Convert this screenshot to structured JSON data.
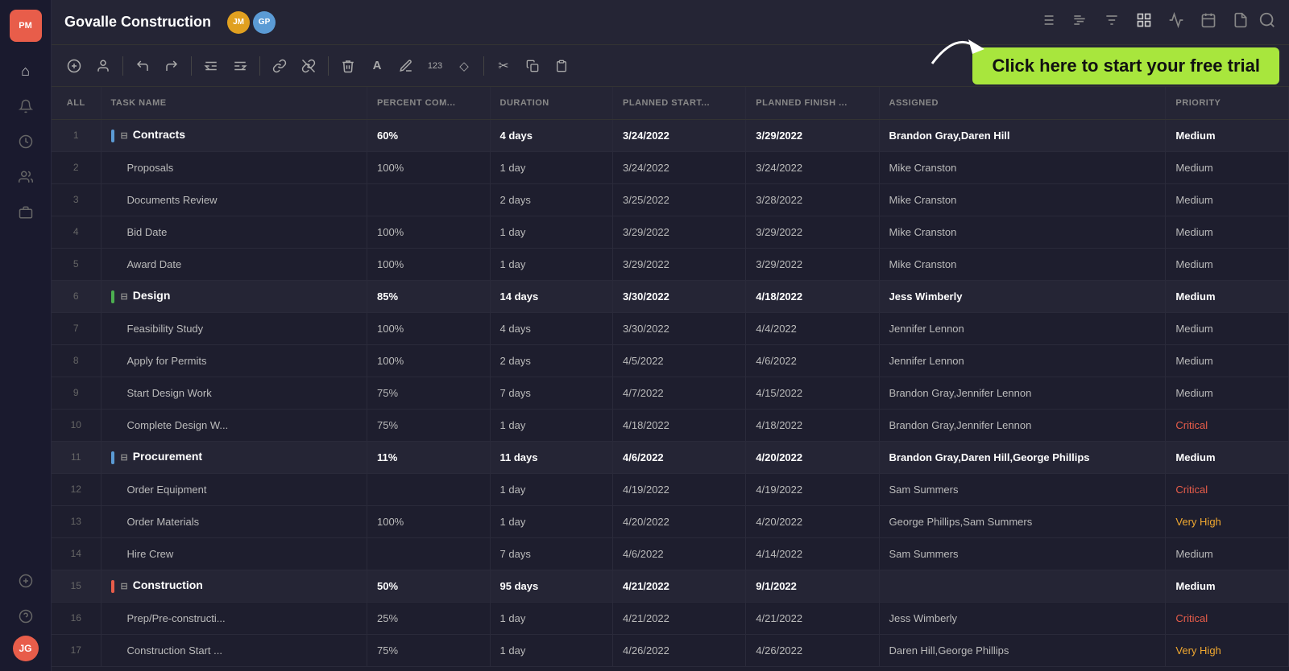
{
  "app": {
    "logo": "PM",
    "project_title": "Govalle Construction",
    "cta_text": "Click here to start your free trial"
  },
  "sidebar": {
    "icons": [
      {
        "name": "home-icon",
        "glyph": "⌂"
      },
      {
        "name": "bell-icon",
        "glyph": "🔔"
      },
      {
        "name": "clock-icon",
        "glyph": "🕐"
      },
      {
        "name": "people-icon",
        "glyph": "👥"
      },
      {
        "name": "briefcase-icon",
        "glyph": "💼"
      },
      {
        "name": "plus-icon",
        "glyph": "+"
      },
      {
        "name": "question-icon",
        "glyph": "?"
      }
    ],
    "user_avatar": "JG"
  },
  "topbar": {
    "avatar1": {
      "initials": "JM",
      "color": "#e0a020"
    },
    "avatar2": {
      "initials": "GP",
      "color": "#5b9bd5"
    },
    "icons": [
      {
        "name": "list-icon",
        "glyph": "☰"
      },
      {
        "name": "chart-icon",
        "glyph": "📊"
      },
      {
        "name": "menu-icon",
        "glyph": "≡"
      },
      {
        "name": "grid-icon",
        "glyph": "⊞"
      },
      {
        "name": "pulse-icon",
        "glyph": "∿"
      },
      {
        "name": "calendar-icon",
        "glyph": "📅"
      },
      {
        "name": "doc-icon",
        "glyph": "📄"
      }
    ]
  },
  "toolbar": {
    "buttons": [
      {
        "name": "add-task-btn",
        "glyph": "⊕"
      },
      {
        "name": "add-user-btn",
        "glyph": "👤"
      },
      {
        "name": "undo-btn",
        "glyph": "↩"
      },
      {
        "name": "redo-btn",
        "glyph": "↪"
      },
      {
        "name": "outdent-btn",
        "glyph": "⇐"
      },
      {
        "name": "indent-btn",
        "glyph": "⇒"
      },
      {
        "name": "link-btn",
        "glyph": "🔗"
      },
      {
        "name": "unlink-btn",
        "glyph": "⛓"
      },
      {
        "name": "delete-btn",
        "glyph": "🗑"
      },
      {
        "name": "font-btn",
        "glyph": "A"
      },
      {
        "name": "highlight-btn",
        "glyph": "✏"
      },
      {
        "name": "number-btn",
        "glyph": "123"
      },
      {
        "name": "shape-btn",
        "glyph": "◇"
      },
      {
        "name": "cut-btn",
        "glyph": "✂"
      },
      {
        "name": "copy-btn",
        "glyph": "⧉"
      },
      {
        "name": "paste-btn",
        "glyph": "📋"
      }
    ]
  },
  "table": {
    "columns": [
      {
        "key": "num",
        "label": "ALL",
        "class": "col-num"
      },
      {
        "key": "task",
        "label": "TASK NAME",
        "class": "col-task"
      },
      {
        "key": "pct",
        "label": "PERCENT COM...",
        "class": "col-pct"
      },
      {
        "key": "dur",
        "label": "DURATION",
        "class": "col-dur"
      },
      {
        "key": "ps",
        "label": "PLANNED START...",
        "class": "col-ps"
      },
      {
        "key": "pf",
        "label": "PLANNED FINISH ...",
        "class": "col-pf"
      },
      {
        "key": "assigned",
        "label": "ASSIGNED",
        "class": "col-assigned"
      },
      {
        "key": "pri",
        "label": "PRIORITY",
        "class": "col-pri"
      }
    ],
    "rows": [
      {
        "num": "1",
        "task": "Contracts",
        "pct": "60%",
        "dur": "4 days",
        "ps": "3/24/2022",
        "pf": "3/29/2022",
        "assigned": "Brandon Gray,Daren Hill",
        "pri": "Medium",
        "type": "group",
        "bar_color": "#5b9bd5"
      },
      {
        "num": "2",
        "task": "Proposals",
        "pct": "100%",
        "dur": "1 day",
        "ps": "3/24/2022",
        "pf": "3/24/2022",
        "assigned": "Mike Cranston",
        "pri": "Medium",
        "type": "child"
      },
      {
        "num": "3",
        "task": "Documents Review",
        "pct": "",
        "dur": "2 days",
        "ps": "3/25/2022",
        "pf": "3/28/2022",
        "assigned": "Mike Cranston",
        "pri": "Medium",
        "type": "child"
      },
      {
        "num": "4",
        "task": "Bid Date",
        "pct": "100%",
        "dur": "1 day",
        "ps": "3/29/2022",
        "pf": "3/29/2022",
        "assigned": "Mike Cranston",
        "pri": "Medium",
        "type": "child"
      },
      {
        "num": "5",
        "task": "Award Date",
        "pct": "100%",
        "dur": "1 day",
        "ps": "3/29/2022",
        "pf": "3/29/2022",
        "assigned": "Mike Cranston",
        "pri": "Medium",
        "type": "child"
      },
      {
        "num": "6",
        "task": "Design",
        "pct": "85%",
        "dur": "14 days",
        "ps": "3/30/2022",
        "pf": "4/18/2022",
        "assigned": "Jess Wimberly",
        "pri": "Medium",
        "type": "group",
        "bar_color": "#4caf50"
      },
      {
        "num": "7",
        "task": "Feasibility Study",
        "pct": "100%",
        "dur": "4 days",
        "ps": "3/30/2022",
        "pf": "4/4/2022",
        "assigned": "Jennifer Lennon",
        "pri": "Medium",
        "type": "child"
      },
      {
        "num": "8",
        "task": "Apply for Permits",
        "pct": "100%",
        "dur": "2 days",
        "ps": "4/5/2022",
        "pf": "4/6/2022",
        "assigned": "Jennifer Lennon",
        "pri": "Medium",
        "type": "child"
      },
      {
        "num": "9",
        "task": "Start Design Work",
        "pct": "75%",
        "dur": "7 days",
        "ps": "4/7/2022",
        "pf": "4/15/2022",
        "assigned": "Brandon Gray,Jennifer Lennon",
        "pri": "Medium",
        "type": "child"
      },
      {
        "num": "10",
        "task": "Complete Design W...",
        "pct": "75%",
        "dur": "1 day",
        "ps": "4/18/2022",
        "pf": "4/18/2022",
        "assigned": "Brandon Gray,Jennifer Lennon",
        "pri": "Critical",
        "type": "child"
      },
      {
        "num": "11",
        "task": "Procurement",
        "pct": "11%",
        "dur": "11 days",
        "ps": "4/6/2022",
        "pf": "4/20/2022",
        "assigned": "Brandon Gray,Daren Hill,George Phillips",
        "pri": "Medium",
        "type": "group",
        "bar_color": "#5b9bd5"
      },
      {
        "num": "12",
        "task": "Order Equipment",
        "pct": "",
        "dur": "1 day",
        "ps": "4/19/2022",
        "pf": "4/19/2022",
        "assigned": "Sam Summers",
        "pri": "Critical",
        "type": "child"
      },
      {
        "num": "13",
        "task": "Order Materials",
        "pct": "100%",
        "dur": "1 day",
        "ps": "4/20/2022",
        "pf": "4/20/2022",
        "assigned": "George Phillips,Sam Summers",
        "pri": "Very High",
        "type": "child"
      },
      {
        "num": "14",
        "task": "Hire Crew",
        "pct": "",
        "dur": "7 days",
        "ps": "4/6/2022",
        "pf": "4/14/2022",
        "assigned": "Sam Summers",
        "pri": "Medium",
        "type": "child"
      },
      {
        "num": "15",
        "task": "Construction",
        "pct": "50%",
        "dur": "95 days",
        "ps": "4/21/2022",
        "pf": "9/1/2022",
        "assigned": "",
        "pri": "Medium",
        "type": "group",
        "bar_color": "#e85d4a"
      },
      {
        "num": "16",
        "task": "Prep/Pre-constructi...",
        "pct": "25%",
        "dur": "1 day",
        "ps": "4/21/2022",
        "pf": "4/21/2022",
        "assigned": "Jess Wimberly",
        "pri": "Critical",
        "type": "child"
      },
      {
        "num": "17",
        "task": "Construction Start ...",
        "pct": "75%",
        "dur": "1 day",
        "ps": "4/26/2022",
        "pf": "4/26/2022",
        "assigned": "Daren Hill,George Phillips",
        "pri": "Very High",
        "type": "child"
      }
    ]
  }
}
